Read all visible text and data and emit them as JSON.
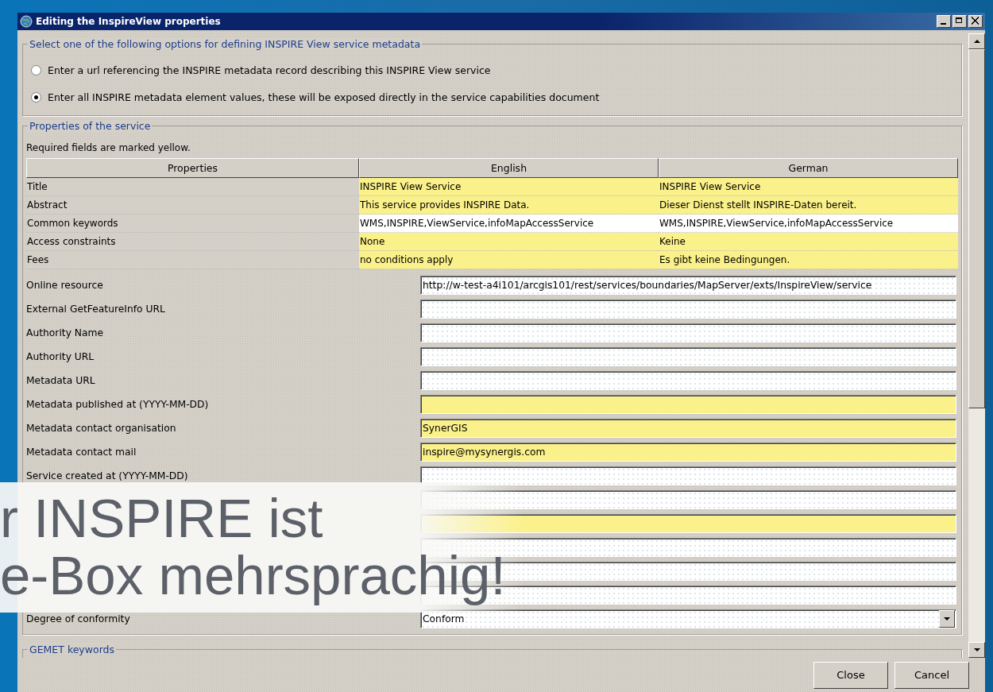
{
  "window": {
    "title": "Editing the InspireView properties"
  },
  "options_group": {
    "legend": "Select one of the following options for defining INSPIRE View service metadata",
    "options": [
      {
        "label": "Enter a url referencing the INSPIRE metadata record describing this INSPIRE View service",
        "selected": false
      },
      {
        "label": "Enter all INSPIRE metadata element values, these will be exposed directly in the service capabilities document",
        "selected": true
      }
    ]
  },
  "properties_group": {
    "legend": "Properties of the service",
    "note": "Required fields are marked yellow.",
    "table": {
      "columns": [
        "Properties",
        "English",
        "German"
      ],
      "rows": [
        {
          "cells": [
            "Title",
            "INSPIRE View Service",
            "INSPIRE View Service"
          ],
          "required": true
        },
        {
          "cells": [
            "Abstract",
            "This service provides INSPIRE Data.",
            "Dieser Dienst stellt INSPIRE-Daten bereit."
          ],
          "required": true
        },
        {
          "cells": [
            "Common keywords",
            "WMS,INSPIRE,ViewService,infoMapAccessService",
            "WMS,INSPIRE,ViewService,infoMapAccessService"
          ],
          "required": false
        },
        {
          "cells": [
            "Access constraints",
            "None",
            "Keine"
          ],
          "required": true
        },
        {
          "cells": [
            "Fees",
            "no conditions apply",
            "Es gibt keine Bedingungen."
          ],
          "required": true
        }
      ]
    },
    "fields": [
      {
        "label": "Online resource",
        "value": "http://w-test-a4i101/arcgis101/rest/services/boundaries/MapServer/exts/InspireView/service",
        "required": false,
        "kind": "text"
      },
      {
        "label": "External GetFeatureInfo URL",
        "required": false,
        "kind": "text"
      },
      {
        "label": "Authority Name",
        "required": false,
        "kind": "text"
      },
      {
        "label": "Authority URL",
        "required": false,
        "kind": "text"
      },
      {
        "label": "Metadata URL",
        "required": false,
        "kind": "text"
      },
      {
        "label": "Metadata published at (YYYY-MM-DD)",
        "required": true,
        "kind": "text"
      },
      {
        "label": "Metadata contact organisation",
        "value": "SynerGIS",
        "required": true,
        "kind": "text"
      },
      {
        "label": "Metadata contact mail",
        "value": "inspire@mysynergis.com",
        "required": true,
        "kind": "text"
      },
      {
        "label": "Service created at (YYYY-MM-DD)",
        "required": false,
        "kind": "text"
      },
      {
        "required": false,
        "kind": "text"
      },
      {
        "required": true,
        "kind": "text"
      },
      {
        "required": false,
        "kind": "text"
      },
      {
        "required": false,
        "kind": "text"
      },
      {
        "required": false,
        "kind": "text"
      },
      {
        "label": "Degree of conformity",
        "value": "Conform",
        "required": false,
        "kind": "dropdown"
      }
    ]
  },
  "gemet_group": {
    "legend": "GEMET keywords"
  },
  "buttons": [
    "Close",
    "Cancel"
  ],
  "overlay": {
    "lines": [
      "r INSPIRE ist",
      "e-Box mehrsprachig!"
    ]
  }
}
